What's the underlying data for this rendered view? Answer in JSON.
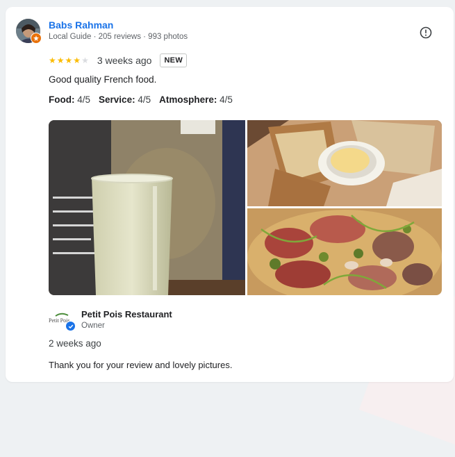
{
  "review": {
    "reviewer_name": "Babs Rahman",
    "reviewer_meta": "Local Guide · 205 reviews · 993 photos",
    "rating": 4,
    "max_rating": 5,
    "date": "3 weeks ago",
    "badge": "NEW",
    "text": "Good quality French food.",
    "subratings": [
      {
        "label": "Food:",
        "value": "4/5"
      },
      {
        "label": "Service:",
        "value": "4/5"
      },
      {
        "label": "Atmosphere:",
        "value": "4/5"
      }
    ]
  },
  "photos": [
    "photo-sparkling-wine",
    "photo-bread-butter",
    "photo-charcuterie"
  ],
  "owner_response": {
    "name": "Petit Pois Restaurant",
    "role": "Owner",
    "date": "2 weeks ago",
    "text": "Thank you for your review and lovely pictures.",
    "logo_text": "Petit Pois"
  },
  "icons": {
    "report": "report-icon",
    "local_guide": "local-guide-badge-icon",
    "verified": "verified-check-icon"
  },
  "colors": {
    "link": "#1a73e8",
    "star": "#fbbc04",
    "star_empty": "#dadce0",
    "guide_badge": "#e8710a"
  }
}
